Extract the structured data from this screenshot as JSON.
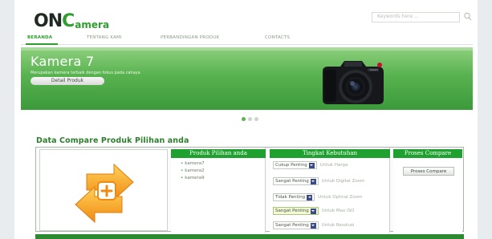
{
  "header": {
    "logo_on": "ON",
    "logo_c": "C",
    "logo_amera": "amera",
    "search_placeholder": "Keywords here ..."
  },
  "nav": {
    "items": [
      "BERANDA",
      "TENTANG KAMI",
      "PERBANDINGAN PRODUK",
      "CONTACTS"
    ],
    "active": "BERANDA"
  },
  "banner": {
    "title": "Kamera 7",
    "subtitle": "Merupakan kamera terbaik dengan fokus pada cahaya",
    "button_label": "Detail Produk",
    "slide_count": 3,
    "active_slide": 1
  },
  "compare": {
    "title": "Data Compare Produk Pilihan anda",
    "col_produk": "Produk Pilihan anda",
    "col_kebutuhan": "Tingkat Kebutuhan",
    "col_proses": "Proses Compare",
    "produk": [
      "kamera7",
      "kamera2",
      "kamera9"
    ],
    "kebutuhan": [
      {
        "level": "Cukup Penting",
        "label": "Untuk Harga"
      },
      {
        "level": "Sangat Penting",
        "label": "Untuk Digital Zoom"
      },
      {
        "level": "Tidak Penting",
        "label": "Untuk Optical Zoom"
      },
      {
        "level": "Sangat Penting",
        "label": "Untuk Max ISO"
      },
      {
        "level": "Sangat Penting",
        "label": "Untuk Resolusi"
      }
    ],
    "proses_button": "Proses Compare"
  },
  "colors": {
    "brand_green": "#2f9e2f",
    "header_green": "#1fa12f",
    "arrow_orange": "#f39a1f"
  },
  "icons": {
    "search": "search-icon",
    "compare": "compare-arrows-icon",
    "camera": "camera-image"
  }
}
